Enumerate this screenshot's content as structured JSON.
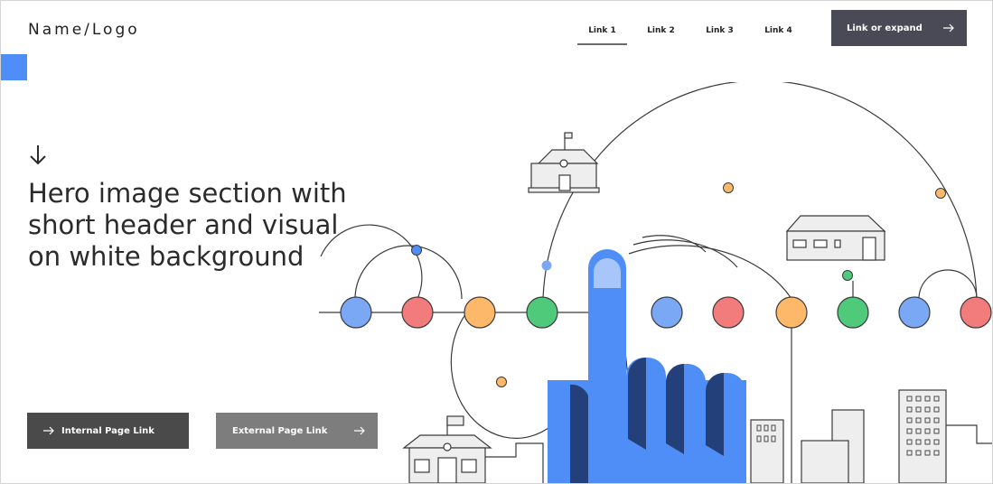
{
  "header": {
    "logo_text": "Name/Logo",
    "nav_links": [
      {
        "label": "Link 1",
        "active": true
      },
      {
        "label": "Link 2",
        "active": false
      },
      {
        "label": "Link 3",
        "active": false
      },
      {
        "label": "Link 4",
        "active": false
      }
    ],
    "cta_label": "Link or expand"
  },
  "hero": {
    "title": "Hero image section with short header and visual on white background"
  },
  "buttons": {
    "internal_label": "Internal Page Link",
    "external_label": "External Page Link"
  },
  "icons": {
    "down_arrow": "arrow-down-icon",
    "right_arrow": "arrow-right-icon"
  },
  "colors": {
    "accent_blue": "#4f8ef7",
    "cta_dark": "#4a4a57",
    "internal_button": "#4a4a4a",
    "external_button": "#7d7d7d",
    "hand_blue": "#4f8ef7",
    "hand_navy": "#23407a",
    "circle_blue": "#7aa8f5",
    "circle_red": "#f27b7b",
    "circle_orange": "#fdb86a",
    "circle_green": "#4fc97a"
  }
}
